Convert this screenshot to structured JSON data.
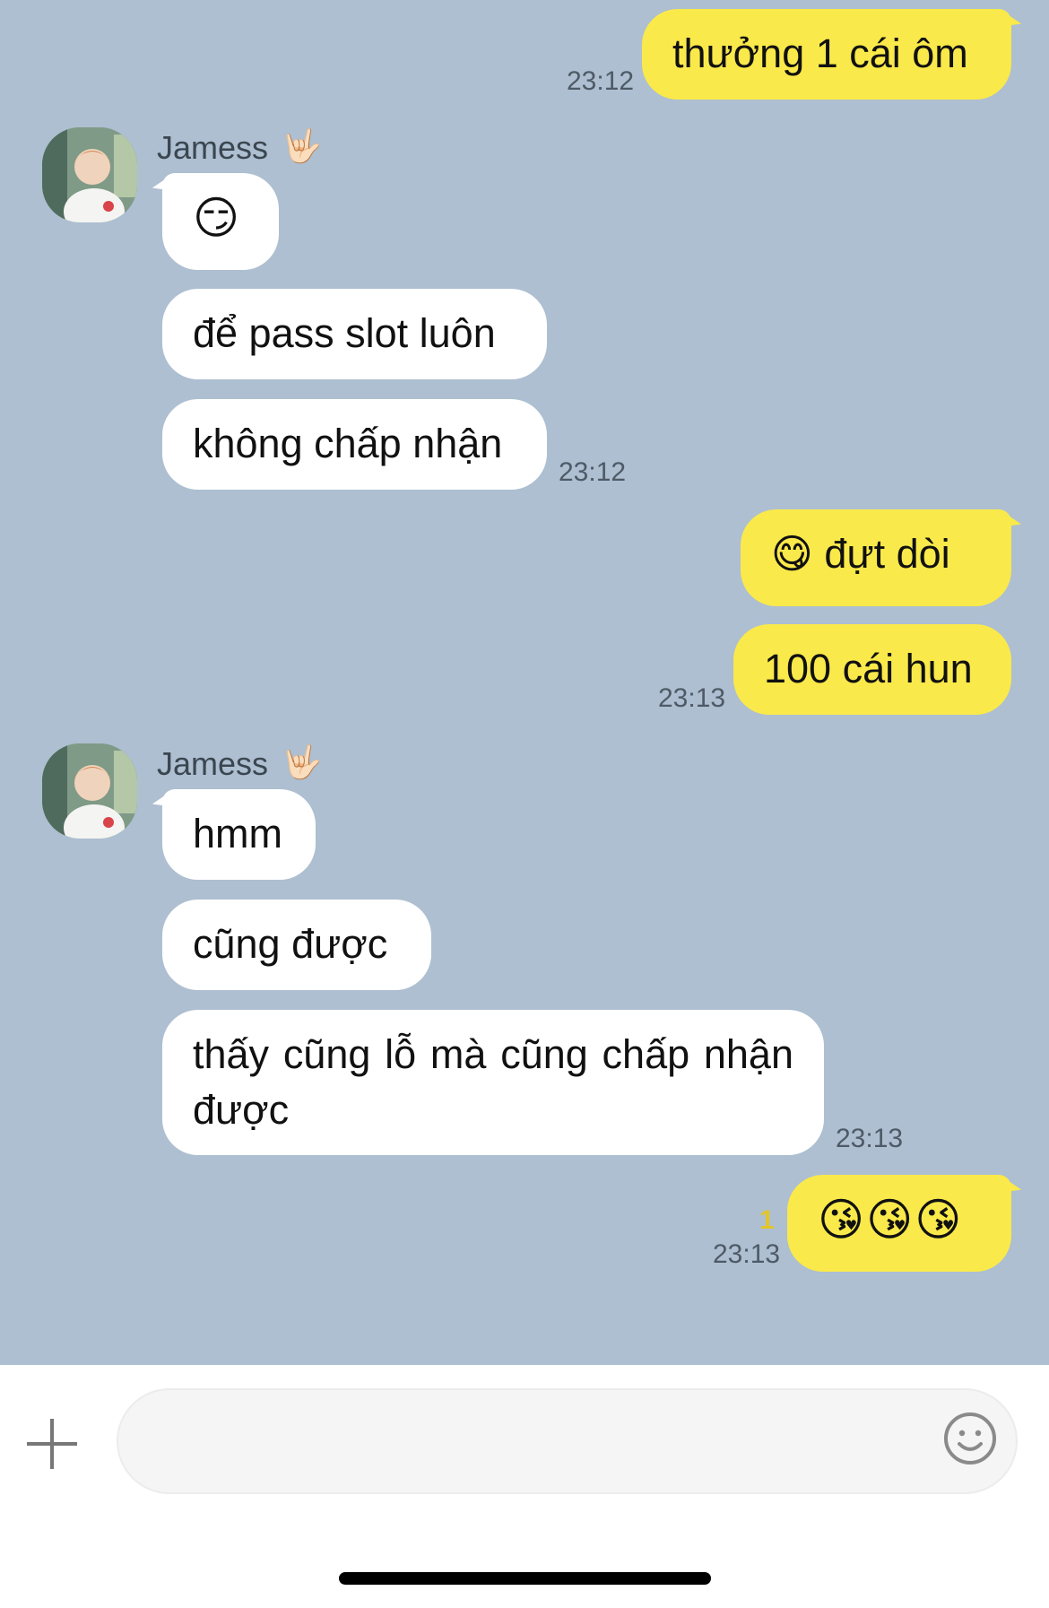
{
  "contact": {
    "name": "Jamess",
    "name_emoji": "🤟🏻"
  },
  "colors": {
    "background": "#adbfd1",
    "outgoing_bubble": "#fae94a",
    "incoming_bubble": "#ffffff"
  },
  "messages": [
    {
      "direction": "out",
      "text": "thưởng 1 cái ôm",
      "time": "23:12"
    },
    {
      "direction": "in",
      "text": "😏"
    },
    {
      "direction": "in",
      "text": "để pass slot luôn"
    },
    {
      "direction": "in",
      "text": "không chấp nhận",
      "time": "23:12"
    },
    {
      "direction": "out",
      "text": "😋 đựt dòi"
    },
    {
      "direction": "out",
      "text": "100 cái hun",
      "time": "23:13"
    },
    {
      "direction": "in",
      "text": "hmm"
    },
    {
      "direction": "in",
      "text": "cũng được"
    },
    {
      "direction": "in",
      "text": "thấy cũng lỗ mà cũng chấp nhận được",
      "time": "23:13"
    },
    {
      "direction": "out",
      "text": "😘😘😘",
      "time": "23:13",
      "unread": "1"
    }
  ],
  "composer": {
    "plus_icon": "plus-icon",
    "emoji_icon": "smiley-icon",
    "value": ""
  }
}
